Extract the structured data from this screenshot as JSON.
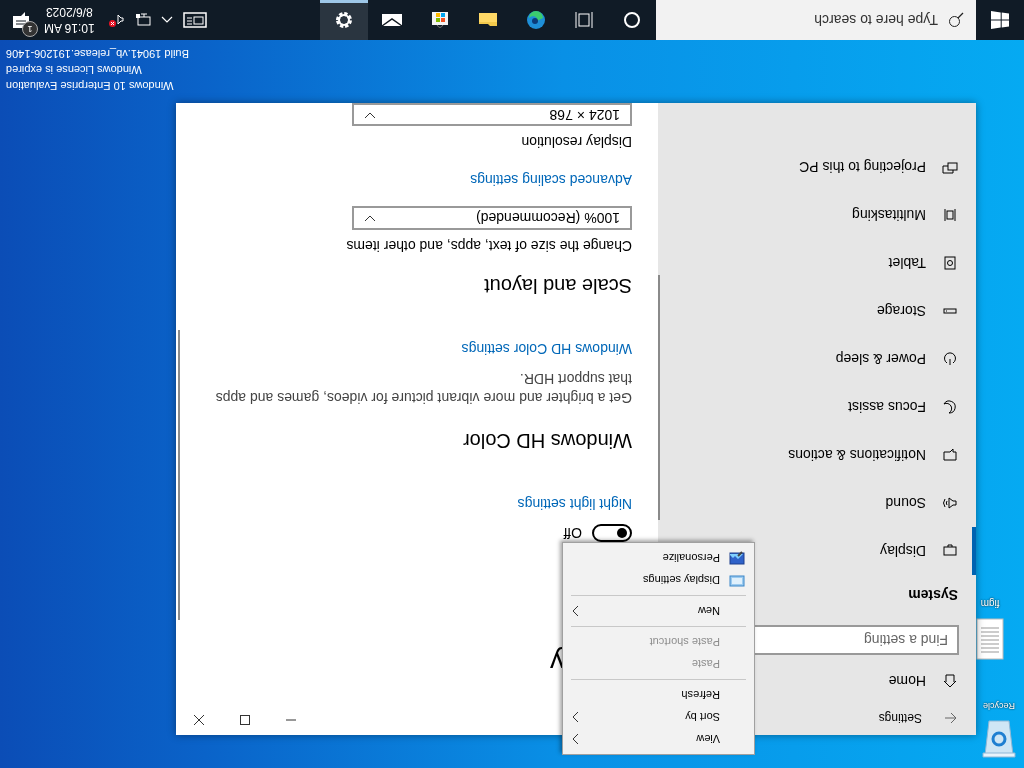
{
  "desktop": {
    "icons": [
      {
        "label": "Recycle"
      },
      {
        "label": "figm"
      }
    ],
    "watermark": [
      "Windows 10 Enterprise Evaluation",
      "Windows License is expired",
      "Build 19041.vb_release.191206-1406"
    ]
  },
  "window": {
    "title": "Settings",
    "nav": {
      "home": "Home",
      "search_placeholder": "Find a setting",
      "section": "System",
      "items": [
        {
          "label": "Display",
          "selected": true
        },
        {
          "label": "Sound",
          "selected": false
        },
        {
          "label": "Notifications & actions",
          "selected": false
        },
        {
          "label": "Focus assist",
          "selected": false
        },
        {
          "label": "Power & sleep",
          "selected": false
        },
        {
          "label": "Storage",
          "selected": false
        },
        {
          "label": "Tablet",
          "selected": false
        },
        {
          "label": "Multitasking",
          "selected": false
        },
        {
          "label": "Projecting to this PC",
          "selected": false
        }
      ]
    },
    "content": {
      "heading": "y",
      "toggle": {
        "label": "Off",
        "on": false
      },
      "night_light_link": "Night light settings",
      "hd_color": {
        "title": "Windows HD Color",
        "description": "Get a brighter and more vibrant picture for videos, games and apps that support HDR.",
        "link": "Windows HD Color settings"
      },
      "scale": {
        "title": "Scale and layout",
        "label": "Change the size of text, apps, and other items",
        "value": "100% (Recommended)",
        "link": "Advanced scaling settings"
      },
      "resolution": {
        "label": "Display resolution",
        "value": "1024 × 768"
      }
    }
  },
  "context_menu": {
    "items": [
      {
        "kind": "plain",
        "label": "View",
        "submenu": true,
        "disabled": false
      },
      {
        "kind": "plain",
        "label": "Sort by",
        "submenu": true,
        "disabled": false
      },
      {
        "kind": "plain",
        "label": "Refresh",
        "submenu": false,
        "disabled": false
      },
      {
        "kind": "separator"
      },
      {
        "kind": "plain",
        "label": "Paste",
        "submenu": false,
        "disabled": true
      },
      {
        "kind": "plain",
        "label": "Paste shortcut",
        "submenu": false,
        "disabled": true
      },
      {
        "kind": "separator"
      },
      {
        "kind": "plain",
        "label": "New",
        "submenu": true,
        "disabled": false
      },
      {
        "kind": "separator"
      },
      {
        "kind": "iconic",
        "label": "Display settings",
        "submenu": false,
        "disabled": false
      },
      {
        "kind": "iconic",
        "label": "Personalize",
        "submenu": false,
        "disabled": false
      }
    ]
  },
  "taskbar": {
    "search_placeholder": "Type here to search",
    "apps": [
      {
        "selected": false
      },
      {
        "selected": false
      },
      {
        "selected": false
      },
      {
        "selected": false
      },
      {
        "selected": false
      },
      {
        "selected": false
      },
      {
        "selected": true
      }
    ],
    "volume_muted": true,
    "clock": {
      "time": "10:16 AM",
      "date": "8/6/2023"
    },
    "notification_count": "1"
  }
}
